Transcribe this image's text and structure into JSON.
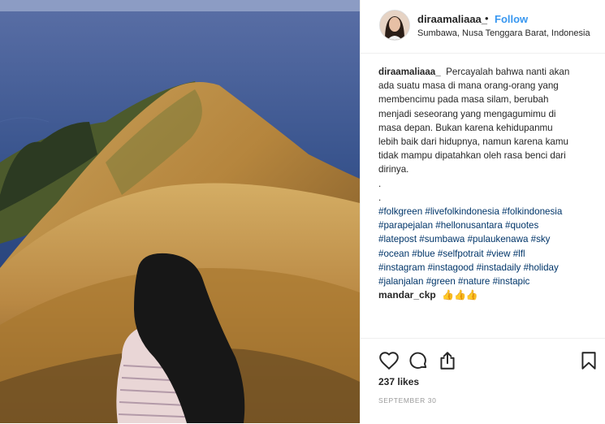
{
  "post": {
    "username": "diraamaliaaa_",
    "separator": "•",
    "follow_label": "Follow",
    "location": "Sumbawa, Nusa Tenggara Barat, Indonesia"
  },
  "caption": {
    "username": "diraamaliaaa_",
    "lines": [
      "Percayalah bahwa nanti akan",
      "ada suatu masa di mana orang-orang yang",
      "membencimu pada masa silam, berubah",
      "menjadi seseorang yang mengagumimu di",
      "masa depan. Bukan karena kehidupanmu",
      "lebih baik dari hidupnya, namun karena kamu",
      "tidak mampu dipatahkan oleh rasa benci dari",
      "dirinya."
    ],
    "dot1": ".",
    "dot2": ".",
    "hashtag_lines": [
      [
        "#folkgreen",
        "#livefolkindonesia",
        "#folkindonesia"
      ],
      [
        "#parapejalan",
        "#hellonusantara",
        "#quotes"
      ],
      [
        "#latepost",
        "#sumbawa",
        "#pulaukenawa",
        "#sky"
      ],
      [
        "#ocean",
        "#blue",
        "#selfpotrait",
        "#view",
        "#lfl"
      ],
      [
        "#instagram",
        "#instagood",
        "#instadaily",
        "#holiday"
      ],
      [
        "#jalanjalan",
        "#green",
        "#nature",
        "#instapic"
      ]
    ]
  },
  "comment": {
    "username": "mandar_ckp",
    "text": "👍👍👍"
  },
  "icons": {
    "like": "heart-icon",
    "comment": "comment-icon",
    "share": "share-icon",
    "save": "bookmark-icon"
  },
  "likes_text": "237 likes",
  "date_text": "SEPTEMBER 30",
  "colors": {
    "link": "#003569",
    "follow": "#3897f0",
    "text": "#262626",
    "muted": "#999999"
  }
}
